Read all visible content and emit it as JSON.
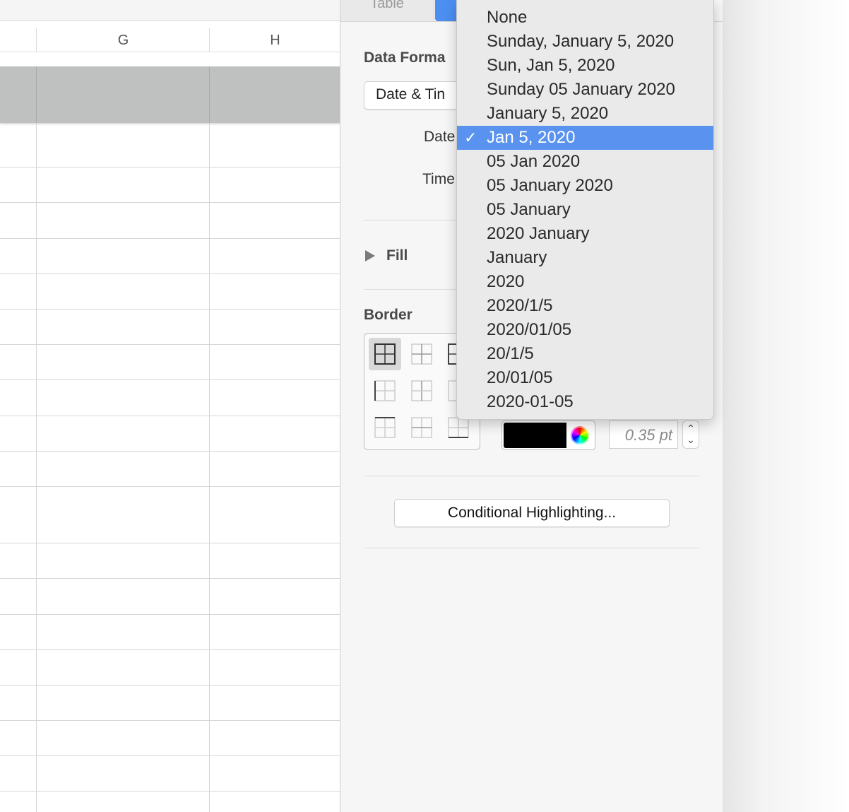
{
  "spreadsheet": {
    "column_headers": [
      "G",
      "H"
    ]
  },
  "inspector": {
    "tabs": [
      "Table",
      ""
    ],
    "data_format": {
      "title": "Data Forma",
      "format_popup": "Date & Tin",
      "date_label": "Date",
      "time_label": "Time"
    },
    "fill": {
      "label": "Fill"
    },
    "border": {
      "title": "Border",
      "color": "#000000",
      "width_value": "0.35 pt"
    },
    "conditional_highlighting_button": "Conditional Highlighting..."
  },
  "date_format_menu": {
    "selected_index": 5,
    "check_glyph": "✓",
    "items": [
      "None",
      "Sunday, January 5, 2020",
      "Sun, Jan 5, 2020",
      "Sunday 05 January 2020",
      "January 5, 2020",
      "Jan 5, 2020",
      "05 Jan 2020",
      "05 January 2020",
      "05 January",
      "2020 January",
      "January",
      "2020",
      "2020/1/5",
      "2020/01/05",
      "20/1/5",
      "20/01/05",
      "2020-01-05"
    ]
  },
  "colors": {
    "accent": "#4c8ff1",
    "menu_selected": "#5a93ef",
    "header_band": "#bfc1c0"
  }
}
